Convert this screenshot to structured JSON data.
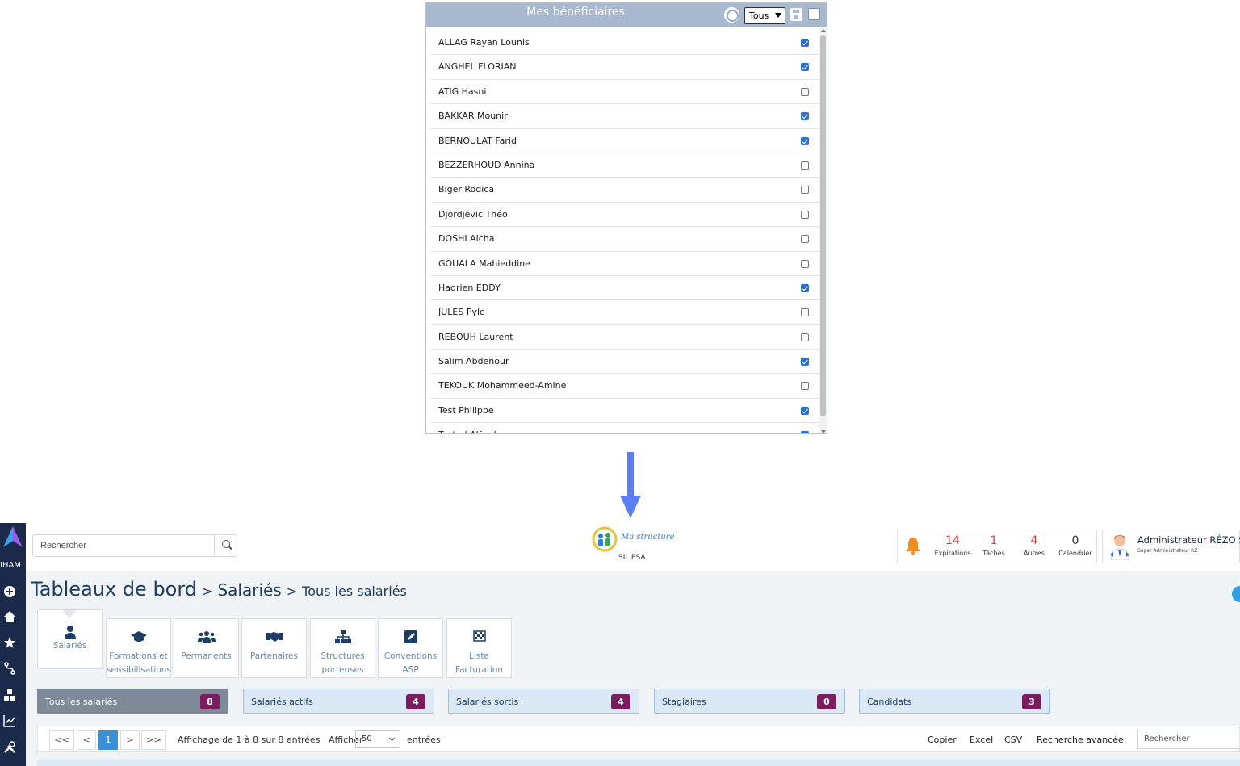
{
  "panel": {
    "title": "Mes bénéficiaires",
    "filter_value": "Tous",
    "icons": [
      "search-icon",
      "save-icon",
      "checkbox-icon"
    ],
    "items": [
      {
        "name": "ALLAG Rayan Lounis",
        "checked": true
      },
      {
        "name": "ANGHEL FLORIAN",
        "checked": true
      },
      {
        "name": "ATIG Hasni",
        "checked": false
      },
      {
        "name": "BAKKAR Mounir",
        "checked": true
      },
      {
        "name": "BERNOULAT Farid",
        "checked": true
      },
      {
        "name": "BEZZERHOUD Annina",
        "checked": false
      },
      {
        "name": "Biger Rodica",
        "checked": false
      },
      {
        "name": "Djordjevic Théo",
        "checked": false
      },
      {
        "name": "DOSHI Aicha",
        "checked": false
      },
      {
        "name": "GOUALA Mahieddine",
        "checked": false
      },
      {
        "name": "Hadrien EDDY",
        "checked": true
      },
      {
        "name": "JULES Pylc",
        "checked": false
      },
      {
        "name": "REBOUH Laurent",
        "checked": false
      },
      {
        "name": "Salim Abdenour",
        "checked": true
      },
      {
        "name": "TEKOUK Mohammeed-Amine",
        "checked": false
      },
      {
        "name": "Test Philippe",
        "checked": true
      },
      {
        "name": "Testud Alfred",
        "checked": true
      }
    ]
  },
  "sidebar": {
    "brand": "IHAM",
    "icons": [
      "plus-circle-icon",
      "home-icon",
      "star-icon",
      "route-icon",
      "boxes-icon",
      "chart-line-icon",
      "tools-icon"
    ]
  },
  "header": {
    "search_placeholder": "Rechercher",
    "structure_name": "Ma structure",
    "structure_sub": "SIL'ESA",
    "stats": [
      {
        "value": "14",
        "label": "Expirations",
        "color": "#e03c3c"
      },
      {
        "value": "1",
        "label": "Tâches",
        "color": "#e03c3c"
      },
      {
        "value": "4",
        "label": "Autres",
        "color": "#e03c3c"
      },
      {
        "value": "0",
        "label": "Calendrier",
        "color": "#333333"
      }
    ],
    "user_name": "Administrateur RÉZO SO",
    "user_role": "Super Administrateur RZ"
  },
  "breadcrumb": {
    "level1": "Tableaux de bord",
    "sep": ">",
    "level2": "Salariés",
    "level3": "Tous les salariés"
  },
  "modules": [
    {
      "label": "Salariés",
      "icon": "user-icon"
    },
    {
      "label": "Formations et sensibilisations",
      "icon": "graduation-cap-icon"
    },
    {
      "label": "Permanents",
      "icon": "users-icon"
    },
    {
      "label": "Partenaires",
      "icon": "handshake-icon"
    },
    {
      "label": "Structures porteuses",
      "icon": "sitemap-icon"
    },
    {
      "label": "Conventions ASP",
      "icon": "edit-icon"
    },
    {
      "label": "Liste Facturation",
      "icon": "flag-checkered-icon"
    }
  ],
  "filters": [
    {
      "label": "Tous les salariés",
      "count": "8"
    },
    {
      "label": "Salariés actifs",
      "count": "4"
    },
    {
      "label": "Salariés sortis",
      "count": "4"
    },
    {
      "label": "Stagiaires",
      "count": "0"
    },
    {
      "label": "Candidats",
      "count": "3"
    }
  ],
  "pager": {
    "first": "<<",
    "prev": "<",
    "page": "1",
    "next": ">",
    "last": ">>",
    "info": "Affichage de 1 à 8 sur 8 entrées",
    "show_label": "Afficher",
    "length": "50",
    "entries_label": "entrées",
    "tools": [
      "Copier",
      "Excel",
      "CSV",
      "Recherche avancée"
    ],
    "search_placeholder": "Rechercher"
  },
  "colors": {
    "sidebar": "#1b2a4a",
    "panel_header": "#a7b8cf",
    "count_badge": "#7a1c5e",
    "arrow": "#5b7ff0",
    "accent": "#3a8fd9"
  }
}
